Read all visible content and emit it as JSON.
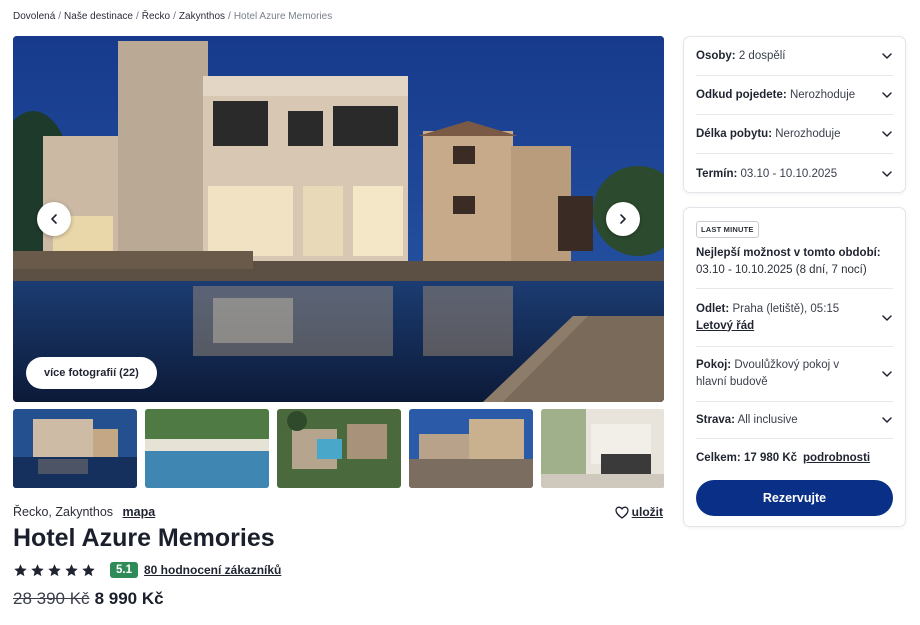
{
  "breadcrumb": [
    "Dovolená",
    "Naše destinace",
    "Řecko",
    "Zakynthos",
    "Hotel Azure Memories"
  ],
  "gallery": {
    "more_photos": "více fotografií (22)"
  },
  "hotel": {
    "location": "Řecko, Zakynthos",
    "map_link": "mapa",
    "save_label": "uložit",
    "name": "Hotel Azure Memories",
    "stars": 5,
    "rating": "5.1",
    "reviews": "80 hodnocení zákazníků",
    "old_price": "28 390 Kč",
    "price": "8 990 Kč"
  },
  "filters": [
    {
      "label": "Osoby:",
      "value": "2 dospělí"
    },
    {
      "label": "Odkud pojedete:",
      "value": "Nerozhoduje"
    },
    {
      "label": "Délka pobytu:",
      "value": "Nerozhoduje"
    },
    {
      "label": "Termín:",
      "value": "03.10 - 10.10.2025"
    }
  ],
  "offer": {
    "badge": "LAST MINUTE",
    "best_title": "Nejlepší možnost v tomto období:",
    "best_dates": "03.10 - 10.10.2025 (8 dní, 7 nocí)",
    "departure_label": "Odlet:",
    "departure_value": "Praha (letiště), 05:15",
    "timetable_link": "Letový řád",
    "room_label": "Pokoj:",
    "room_value": "Dvoulůžkový pokoj v hlavní budově",
    "board_label": "Strava:",
    "board_value": "All inclusive",
    "total_label": "Celkem:",
    "total_value": "17 980 Kč",
    "details_link": "podrobnosti",
    "reserve_button": "Rezervujte"
  },
  "colors": {
    "primary": "#0a2f86",
    "rating_badge": "#2e8b57",
    "night_sky": "#1b3f8f",
    "pool": "#123060"
  }
}
